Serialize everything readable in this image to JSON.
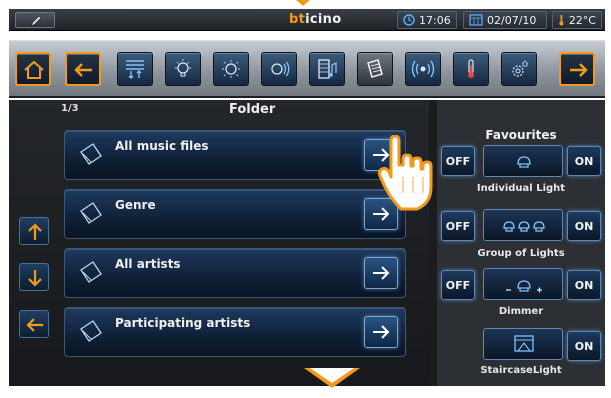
{
  "status_bar": {
    "brand_prefix": "bt",
    "brand_suffix": "icino",
    "time": "17:06",
    "date": "02/07/10",
    "temperature": "22°C"
  },
  "toolbar": {
    "buttons": [
      "home-icon",
      "back-arrow-icon",
      "menu-list-icon",
      "lightbulb-icon",
      "sun-icon",
      "shutter-icon",
      "video-icon",
      "music-docs-icon",
      "wireless-icon",
      "thermometer-icon",
      "gear-house-icon",
      "forward-arrow-icon"
    ]
  },
  "folder": {
    "page": "1/3",
    "title": "Folder",
    "items": [
      {
        "label": "All music files"
      },
      {
        "label": "Genre"
      },
      {
        "label": "All artists"
      },
      {
        "label": "Participating artists"
      }
    ]
  },
  "favourites": {
    "title": "Favourites",
    "off_label": "OFF",
    "on_label": "ON",
    "entries": [
      {
        "label": "Individual Light"
      },
      {
        "label": "Group of Lights"
      },
      {
        "label": "Dimmer"
      },
      {
        "label": "StaircaseLight"
      }
    ]
  },
  "colors": {
    "accent_orange": "#f39a1e",
    "button_blue": "#1e3a5e",
    "glow_blue": "#5f88b4"
  }
}
